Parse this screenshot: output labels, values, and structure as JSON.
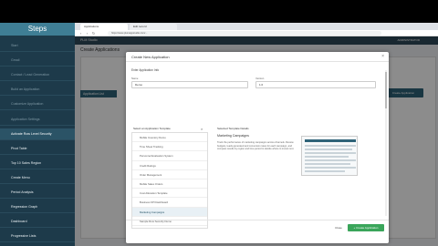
{
  "steps": {
    "title": "Steps",
    "items": [
      {
        "label": "Start",
        "state": "done"
      },
      {
        "label": "Gmail",
        "state": "done"
      },
      {
        "label": "Contact / Lead Generation",
        "state": "done"
      },
      {
        "label": "Build an Application",
        "state": "done"
      },
      {
        "label": "Customize Application",
        "state": "done"
      },
      {
        "label": "Application Settings",
        "state": "done"
      },
      {
        "label": "Activate Row Level Security",
        "state": "active"
      },
      {
        "label": "Pivot Table",
        "state": "todo"
      },
      {
        "label": "Top 10 Sales Region",
        "state": "todo"
      },
      {
        "label": "Create Menu",
        "state": "todo"
      },
      {
        "label": "Period Analysis",
        "state": "todo"
      },
      {
        "label": "Regression Graph",
        "state": "todo"
      },
      {
        "label": "Dashboard",
        "state": "todo"
      },
      {
        "label": "Progressive Lists",
        "state": "todo"
      }
    ]
  },
  "browser": {
    "tab1": "Applications",
    "tab2": "Edit record",
    "url": "https://www.plumappstudio.com/..."
  },
  "app": {
    "logo": "PLM Studio",
    "user": "ADMINISTRATOR",
    "page_title": "Create Applications",
    "list_tab": "Application List",
    "new_button": "Create Application"
  },
  "modal": {
    "title": "Create New Application",
    "close": "×",
    "section": "Enter Application Info",
    "name_label": "Name",
    "name_value": "Demo",
    "version_label": "Version",
    "version_value": "1.0",
    "templates_label": "Select an Application Template",
    "templates": [
      "Mobile Inventory Demo",
      "Time Sheet Tracking",
      "Personnel Evaluation System",
      "Credit Ratings",
      "Order Management",
      "Mobile Sales Orders",
      "Cost Allocation Template",
      "Business KPI Dashboard",
      "Marketing Campaigns",
      "Sample Row Security Demo"
    ],
    "selected_template": 8,
    "preview_label": "Selected Template Details",
    "detail_title": "Marketing Campaigns",
    "detail_desc": "Track the performance of marketing campaigns across channels. Review budgets, leads generated and conversion rates for each campaign, and compare results by region and time period to decide where to invest next.",
    "cancel": "Close",
    "create": "+ Create Application"
  },
  "colors": {
    "sidebar": "#1d3a4a",
    "accent": "#3f7e95",
    "create_green": "#3aa55a"
  }
}
